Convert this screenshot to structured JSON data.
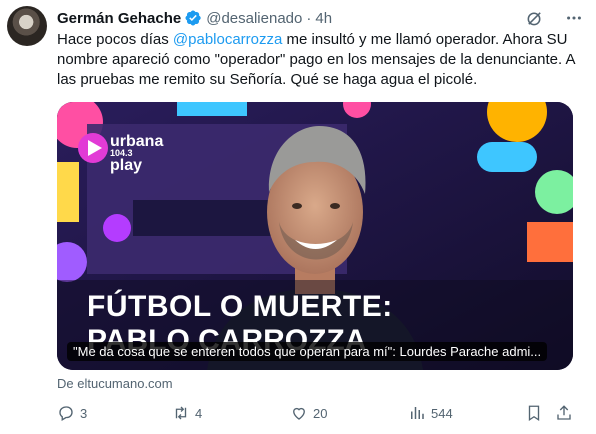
{
  "author": {
    "name": "Germán Gehache",
    "handle": "@desalienado",
    "separator": "·",
    "time": "4h"
  },
  "tweet": {
    "text_before_mention": "Hace pocos días ",
    "mention": "@pablocarrozza",
    "text_after_mention": " me insultó y me llamó operador. Ahora SU nombre apareció como \"operador\" pago en los mensajes de la denunciante. A las pruebas me remito su Señoría. Qué se haga agua el picolé."
  },
  "card": {
    "logo_line1": "urbana",
    "logo_line2": "104.3",
    "logo_line3": "play",
    "headline_line1": "FÚTBOL O MUERTE:",
    "headline_line2": "PABLO CARROZZA",
    "caption": "\"Me da cosa que se enteren todos que operan para mí\": Lourdes Parache admi...",
    "source": "De eltucumano.com"
  },
  "actions": {
    "replies": "3",
    "reposts": "4",
    "likes": "20",
    "views": "544"
  },
  "colors": {
    "accent": "#1d9bf0",
    "secondary_text": "#536471"
  }
}
